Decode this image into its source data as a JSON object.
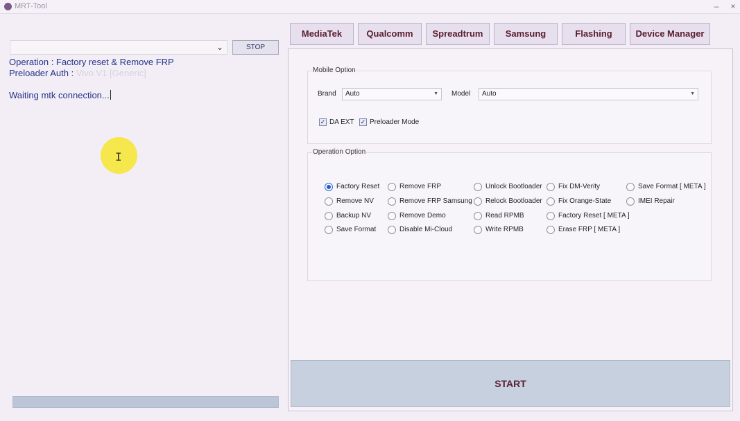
{
  "window": {
    "title": "MRT-Tool",
    "minimize": "–",
    "close": "×"
  },
  "left": {
    "port_select_value": "",
    "stop_label": "STOP",
    "log": {
      "operation": "Operation : Factory reset & Remove FRP",
      "preloader_label": "Preloader Auth : ",
      "preloader_value": "Vivo V1 [Generic]",
      "waiting": "Waiting mtk connection..."
    },
    "progress_fraction": 0
  },
  "tabs": [
    "MediaTek",
    "Qualcomm",
    "Spreadtrum",
    "Samsung",
    "Flashing",
    "Device Manager"
  ],
  "mobile_option": {
    "title": "Mobile Option",
    "brand_label": "Brand",
    "brand_value": "Auto",
    "model_label": "Model",
    "model_value": "Auto",
    "da_ext_label": "DA EXT",
    "preloader_mode_label": "Preloader Mode"
  },
  "operation_option": {
    "title": "Operation Option",
    "selected": "Factory Reset",
    "options": [
      [
        "Factory Reset",
        "Remove NV",
        "Backup NV",
        "Save Format"
      ],
      [
        "Remove FRP",
        "Remove FRP Samsung",
        "Remove Demo",
        "Disable Mi-Cloud"
      ],
      [
        "Unlock Bootloader",
        "Relock Bootloader",
        "Read RPMB",
        "Write RPMB"
      ],
      [
        "Fix DM-Verity",
        "Fix Orange-State",
        "Factory Reset [ META ]",
        "Erase FRP [ META ]"
      ],
      [
        "Save Format [ META ]",
        "IMEI Repair"
      ]
    ]
  },
  "start_label": "START"
}
